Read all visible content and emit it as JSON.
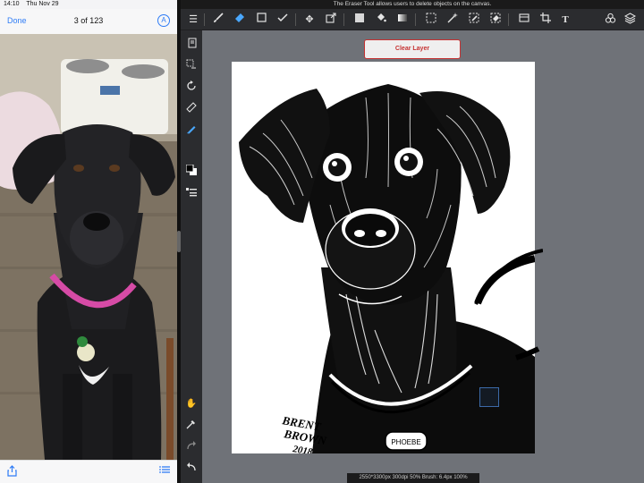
{
  "photos": {
    "status_time": "14:10",
    "status_date": "Thu Nov 29",
    "done_label": "Done",
    "count_label": "3 of 123",
    "markup_glyph": "A",
    "share_icon": "share-icon",
    "list_icon": "list-icon"
  },
  "app": {
    "tooltip": "The Eraser Tool allows users to delete objects on the canvas.",
    "clear_layer_label": "Clear Layer",
    "status_text": "2550*3300px 300dpi 50% Brush: 6.4px 100%",
    "accent_color": "#4aa8ff",
    "clear_color": "#c63232"
  },
  "toolbar": {
    "items": [
      "menu-icon",
      "brush-icon",
      "eraser-icon",
      "rectangle-icon",
      "smudge-icon",
      "move-icon",
      "transform-icon",
      "fill-color-icon",
      "bucket-icon",
      "gradient-icon",
      "select-rect-icon",
      "magic-wand-icon",
      "select-pen-icon",
      "select-eraser-icon",
      "panel-icon",
      "crop-icon",
      "text-icon",
      "3d-icon",
      "layers-icon"
    ],
    "selected": "eraser-icon"
  },
  "sidebar": {
    "items": [
      "pages-icon",
      "selection-icon",
      "rotate-icon",
      "ruler-icon",
      "pen-icon",
      "color-swatch-icon",
      "layer-props-icon",
      "hand-icon",
      "eyedropper-icon",
      "redo-icon",
      "undo-icon"
    ],
    "selected": "pen-icon"
  },
  "artwork": {
    "signature_line1": "BRENT",
    "signature_line2": "BROWN",
    "signature_year": "2018",
    "tag_text": "PHOEBE"
  }
}
